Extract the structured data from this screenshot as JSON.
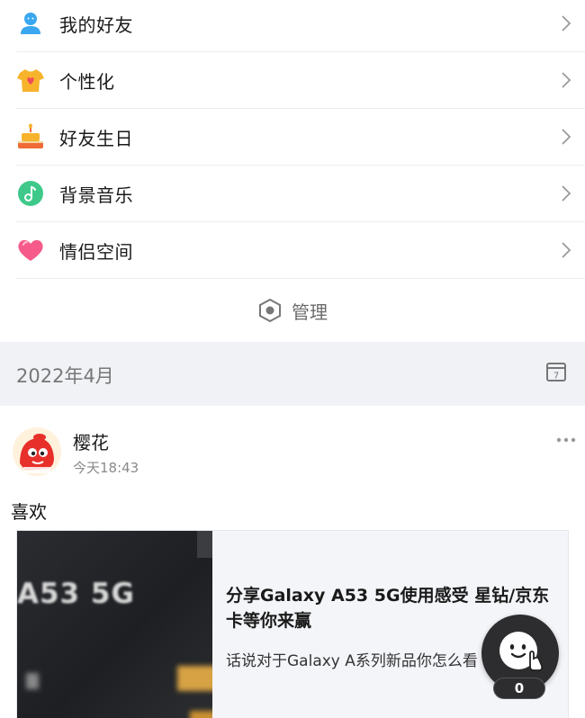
{
  "menu": {
    "items": [
      {
        "label": "我的好友",
        "icon": "friend-icon"
      },
      {
        "label": "个性化",
        "icon": "tshirt-icon"
      },
      {
        "label": "好友生日",
        "icon": "cake-icon"
      },
      {
        "label": "背景音乐",
        "icon": "music-icon"
      },
      {
        "label": "情侣空间",
        "icon": "heart-icon"
      }
    ]
  },
  "manage": {
    "label": "管理",
    "icon": "hexagon-icon"
  },
  "date_bar": {
    "label": "2022年4月",
    "icon": "calendar-icon",
    "calendar_day": "7"
  },
  "post": {
    "author": "樱花",
    "timestamp": "今天18:43",
    "text": "喜欢",
    "share": {
      "thumb_text": "A53 5G",
      "title": "分享Galaxy A53 5G使用感受 星钻/京东卡等你来赢",
      "description": "话说对于Galaxy A系列新品你怎么看"
    }
  },
  "fab": {
    "count": "0"
  },
  "colors": {
    "accent_blue": "#3aa7f0",
    "divider": "#ececec",
    "date_bg": "#f1f2f6",
    "fab_bg": "#2d2d2f"
  }
}
